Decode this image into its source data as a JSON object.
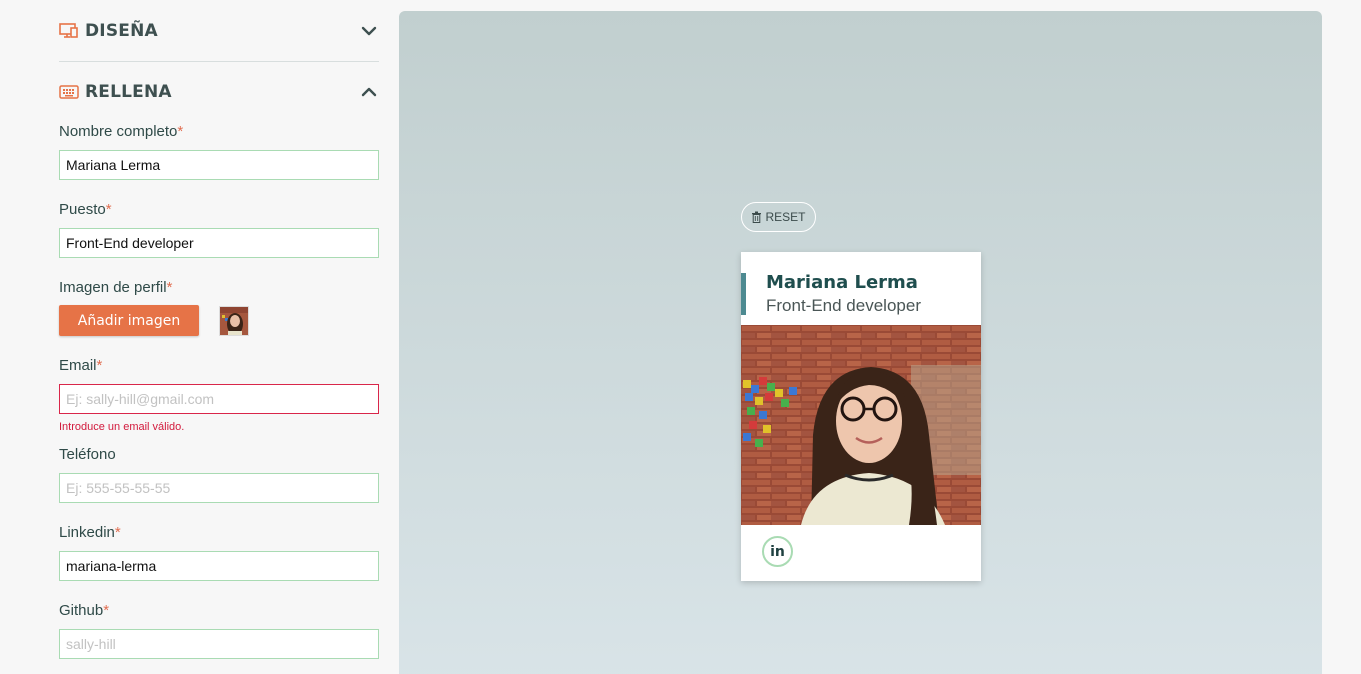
{
  "sections": {
    "design": {
      "title": "DISEÑA",
      "icon": "monitor-icon",
      "expanded": false
    },
    "fill": {
      "title": "RELLENA",
      "icon": "keyboard-icon",
      "expanded": true
    }
  },
  "form": {
    "required_mark": "*",
    "full_name": {
      "label": "Nombre completo",
      "value": "Mariana Lerma",
      "placeholder": ""
    },
    "job": {
      "label": "Puesto",
      "value": "Front-End developer",
      "placeholder": ""
    },
    "image": {
      "label": "Imagen de perfil",
      "button_label": "Añadir imagen"
    },
    "email": {
      "label": "Email",
      "value": "",
      "placeholder": "Ej: sally-hill@gmail.com",
      "error": "Introduce un email válido."
    },
    "phone": {
      "label": "Teléfono",
      "value": "",
      "placeholder": "Ej: 555-55-55-55"
    },
    "linkedin": {
      "label": "Linkedin",
      "value": "mariana-lerma",
      "placeholder": ""
    },
    "github": {
      "label": "Github",
      "value": "",
      "placeholder": "sally-hill"
    }
  },
  "preview": {
    "reset_label": "RESET",
    "card": {
      "name": "Mariana Lerma",
      "job": "Front-End developer",
      "social": [
        {
          "icon": "linkedin-icon",
          "label": "in"
        }
      ]
    }
  },
  "colors": {
    "accent_orange": "#e67347",
    "field_border": "#a9dbb3",
    "error_red": "#d21a3c",
    "card_accent": "#4d8a91",
    "card_name": "#1f4e4e"
  }
}
